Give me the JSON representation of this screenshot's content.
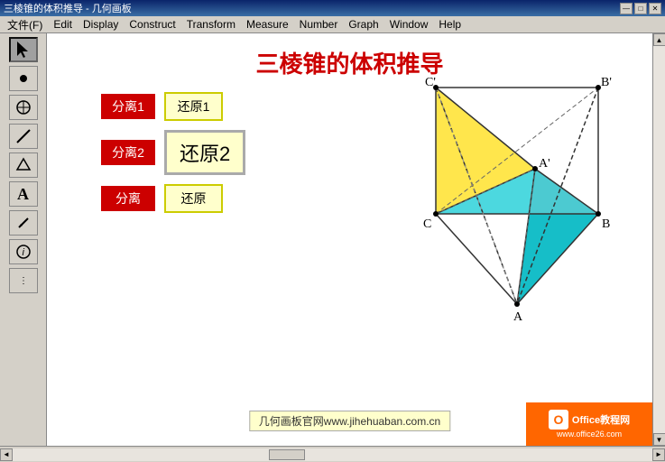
{
  "titlebar": {
    "title": "三棱锥的体积推导 - 几何画板",
    "min": "—",
    "max": "□",
    "close": "✕"
  },
  "menu": {
    "items": [
      "文件(F)",
      "Edit",
      "Display",
      "Construct",
      "Transform",
      "Measure",
      "Number",
      "Graph",
      "Window",
      "Help"
    ]
  },
  "page": {
    "title": "三棱锥的体积推导"
  },
  "buttons": {
    "sep1": "分离1",
    "restore1": "还原1",
    "sep2": "分离2",
    "restore2": "还原2",
    "sep3": "分离",
    "restore3": "还原"
  },
  "watermark": "几何画板官网www.jihehuaban.com.cn",
  "office": {
    "line1": "Office教程网",
    "line2": "www.office26.com"
  },
  "geometry": {
    "labels": {
      "C_prime": "C'",
      "B_prime": "B'",
      "A_prime": "A'",
      "C": "C",
      "B": "B",
      "A": "A"
    }
  }
}
